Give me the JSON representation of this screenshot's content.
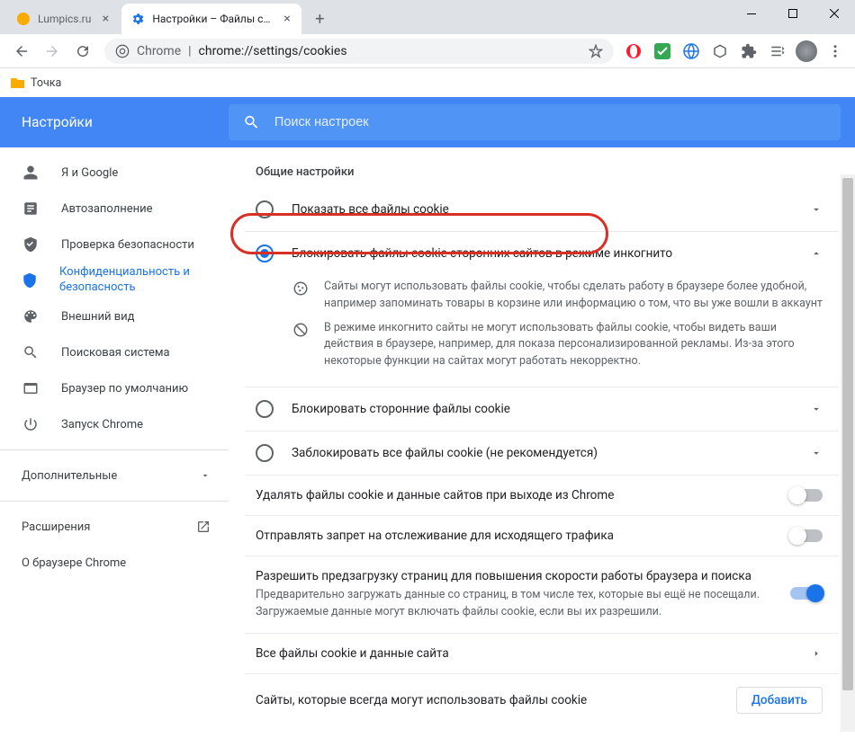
{
  "tabs": [
    {
      "label": "Lumpics.ru",
      "active": false
    },
    {
      "label": "Настройки – Файлы cookie и д",
      "active": true
    }
  ],
  "url_prefix": "Chrome",
  "url_path": "chrome://settings/cookies",
  "bookmark": "Точка",
  "header": {
    "title": "Настройки",
    "search_placeholder": "Поиск настроек"
  },
  "sidebar": {
    "items": [
      {
        "label": "Я и Google"
      },
      {
        "label": "Автозаполнение"
      },
      {
        "label": "Проверка безопасности"
      },
      {
        "label": "Конфиденциальность и безопасность"
      },
      {
        "label": "Внешний вид"
      },
      {
        "label": "Поисковая система"
      },
      {
        "label": "Браузер по умолчанию"
      },
      {
        "label": "Запуск Chrome"
      }
    ],
    "more": "Дополнительные",
    "ext": "Расширения",
    "about": "О браузере Chrome"
  },
  "section_title": "Общие настройки",
  "options": [
    {
      "label": "Показать все файлы cookie"
    },
    {
      "label": "Блокировать файлы cookie сторонних сайтов в режиме инкогнито"
    },
    {
      "label": "Блокировать сторонние файлы cookie"
    },
    {
      "label": "Заблокировать все файлы cookie (не рекомендуется)"
    }
  ],
  "expanded": {
    "line1": "Сайты могут использовать файлы cookie, чтобы сделать работу в браузере более удобной, например запоминать товары в корзине или информацию о том, что вы уже вошли в аккаунт",
    "line2": "В режиме инкогнито сайты не могут использовать файлы cookie, чтобы видеть ваши действия в браузере, например, для показа персонализированной рекламы. Из-за этого некоторые функции на сайтах могут работать некорректно."
  },
  "rows": {
    "clear_on_exit": "Удалять файлы cookie и данные сайтов при выходе из Chrome",
    "dnt": "Отправлять запрет на отслеживание для исходящего трафика",
    "preload_title": "Разрешить предзагрузку страниц для повышения скорости работы браузера и поиска",
    "preload_sub": "Предварительно загружать данные со страниц, в том числе тех, которые вы ещё не посещали. Загружаемые данные могут включать файлы cookie, если вы их разрешили.",
    "all_cookies": "Все файлы cookie и данные сайта",
    "always_allow": "Сайты, которые всегда могут использовать файлы cookie",
    "add": "Добавить"
  }
}
